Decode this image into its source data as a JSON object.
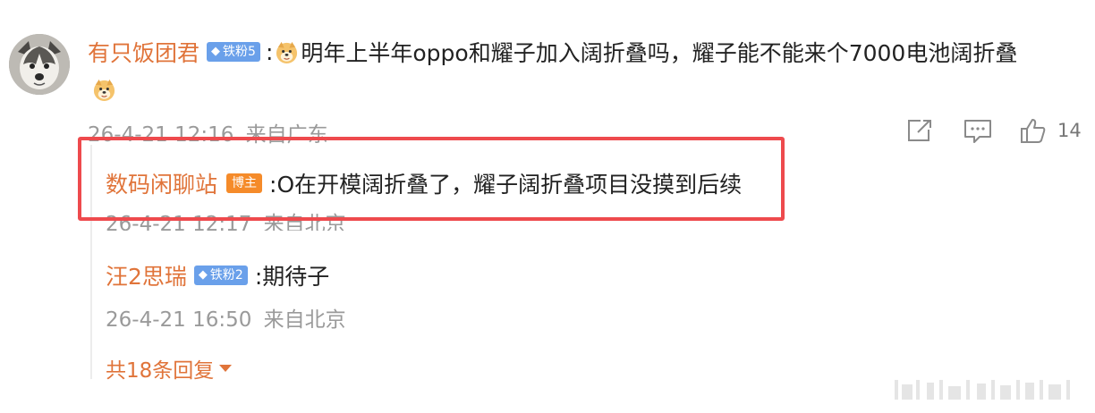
{
  "comment": {
    "username": "有只饭团君",
    "badge": "铁粉5",
    "separator": ":",
    "text_line1": "明年上半年oppo和耀子加入阔折叠吗，耀子能不能来个7000电池阔折叠",
    "timestamp": "26-4-21 12:16",
    "location": "来自广东",
    "like_count": "14"
  },
  "replies": [
    {
      "username": "数码闲聊站",
      "badge": "博主",
      "text": ":O在开模阔折叠了，耀子阔折叠项目没摸到后续",
      "timestamp": "26-4-21 12:17",
      "location": "来自北京"
    },
    {
      "username": "汪2思瑞",
      "badge": "铁粉2",
      "text": ":期待子",
      "timestamp": "26-4-21 16:50",
      "location": "来自北京"
    }
  ],
  "more_replies_label": "共18条回复",
  "colors": {
    "username": "#e0743a",
    "highlight_box": "#ee4a4d",
    "fan_badge": "#6aa0ea",
    "blogger_badge": "#f58b2a",
    "meta_text": "#9a9a9a"
  },
  "icons": [
    "share-icon",
    "comment-icon",
    "like-icon",
    "doge-emoji",
    "chevron-down-icon"
  ]
}
